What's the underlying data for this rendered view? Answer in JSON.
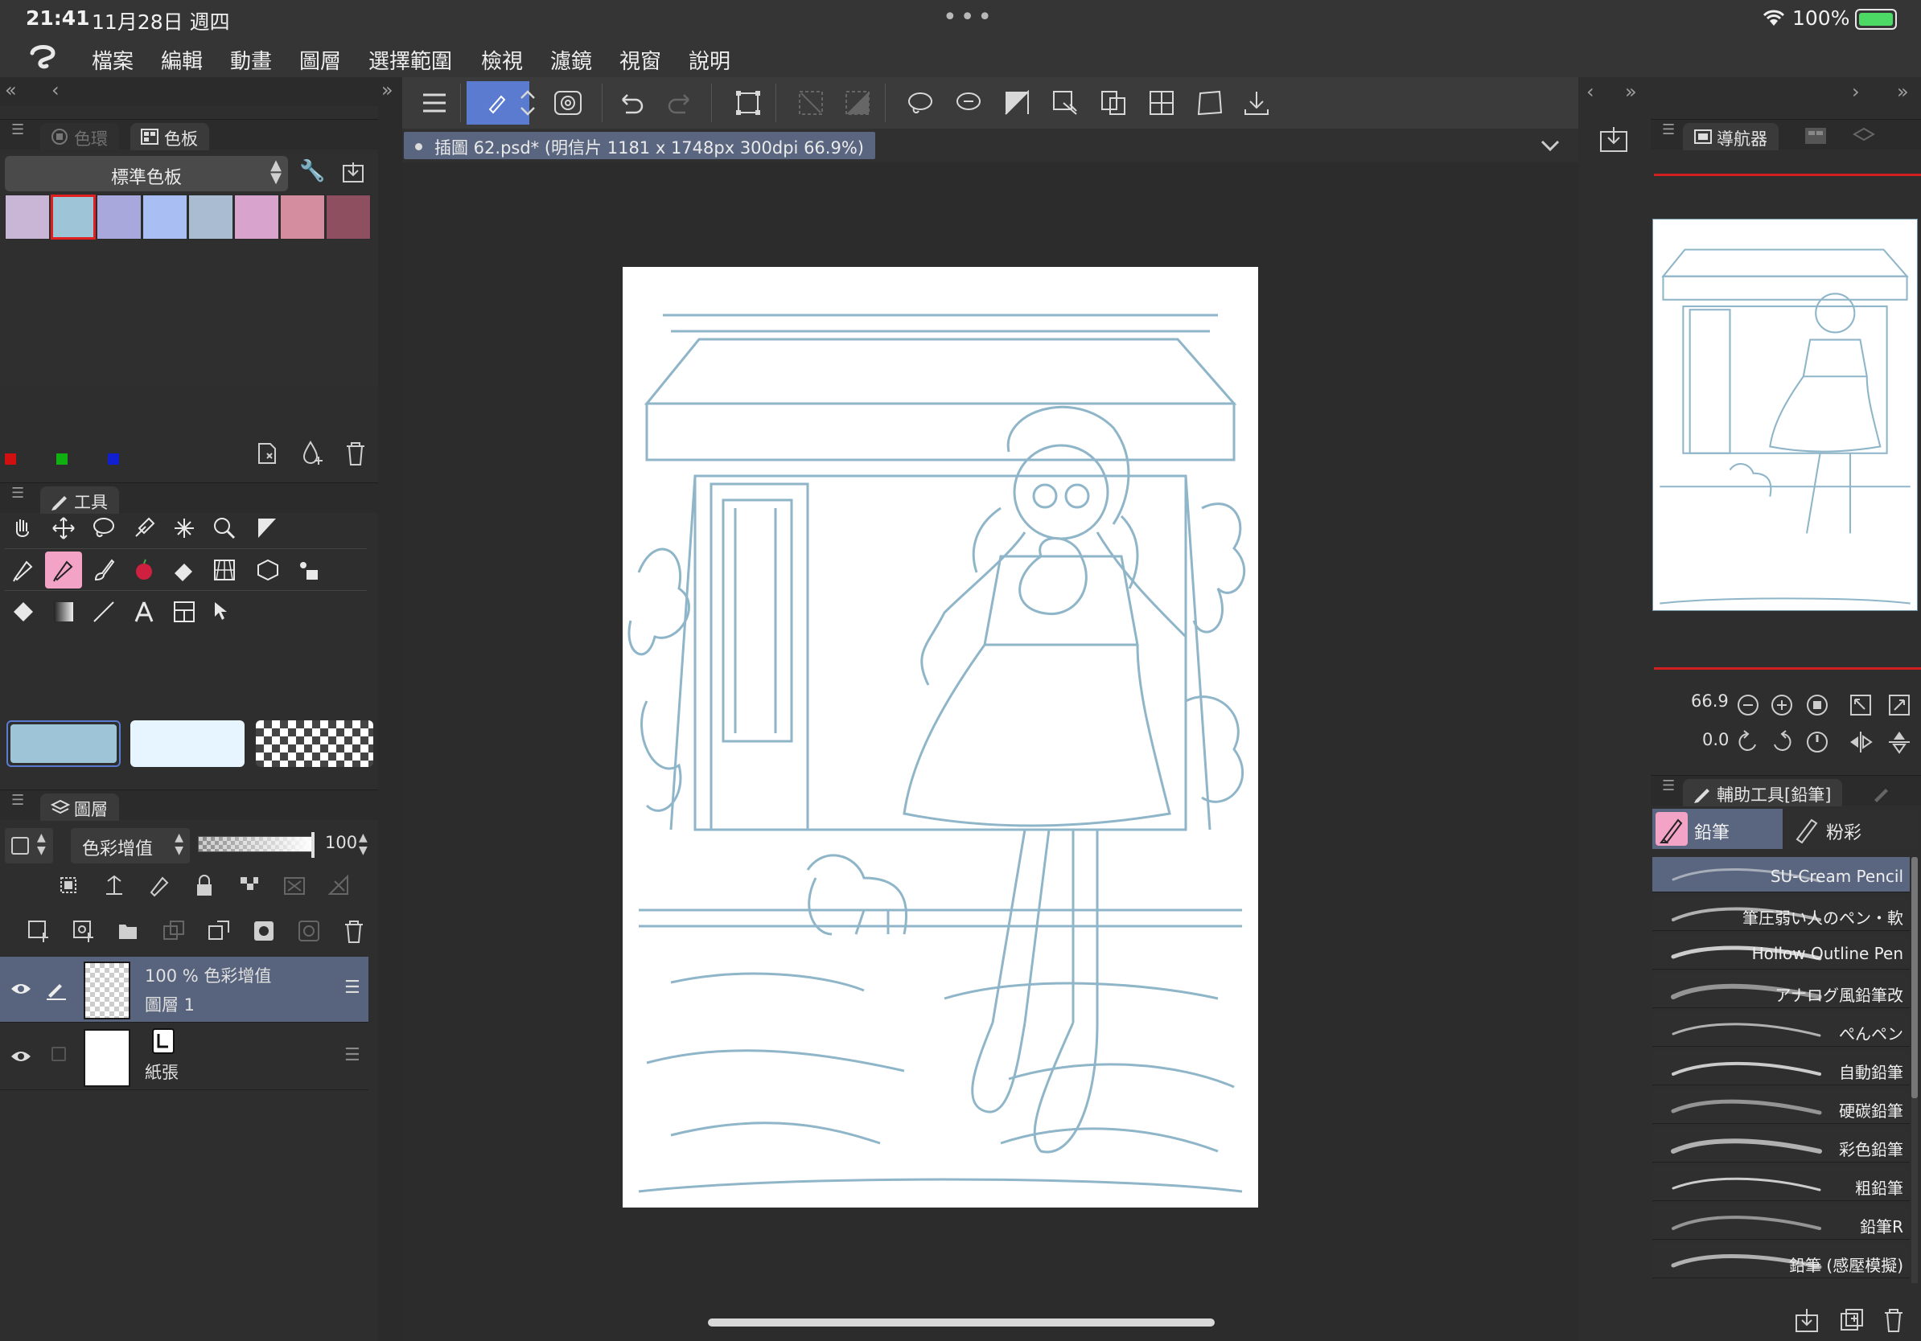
{
  "status": {
    "time": "21:41",
    "date": "11月28日 週四",
    "battery": "100%"
  },
  "menu": [
    "檔案",
    "編輯",
    "動畫",
    "圖層",
    "選擇範圍",
    "檢視",
    "濾鏡",
    "視窗",
    "說明"
  ],
  "palette_panel": {
    "tab_inactive": "色環",
    "tab_active": "色板",
    "palette_name": "標準色板",
    "swatches": [
      "#c9b6d6",
      "#9ec4d8",
      "#a8a8dc",
      "#a9bff4",
      "#a9bcd2",
      "#d8a3cc",
      "#d38d9e",
      "#8e5060"
    ]
  },
  "tool_panel": {
    "tab": "工具",
    "main_color": "#9ec4d8",
    "sub_color": "#e6f5ff"
  },
  "layer_panel": {
    "tab": "圖層",
    "blend_mode": "色彩增值",
    "opacity": "100",
    "opacity_fraction": 1.0,
    "layers": [
      {
        "mode": "100 % 色彩增值",
        "name": "圖層 1"
      },
      {
        "mode": "",
        "name": "紙張"
      }
    ]
  },
  "document": {
    "tab_label": "插圖 62.psd* (明信片 1181 x 1748px 300dpi 66.9%)"
  },
  "navigator": {
    "tab": "導航器",
    "zoom": "66.9",
    "rotation": "0.0"
  },
  "sub_tool": {
    "tab": "輔助工具[鉛筆]",
    "groups": [
      "鉛筆",
      "粉彩"
    ],
    "brushes": [
      "SU-Cream Pencil",
      "筆圧弱い人のペン・軟",
      "Hollow Outline Pen",
      "アナログ風鉛筆改",
      "ぺんペン",
      "自動鉛筆",
      "硬碳鉛筆",
      "彩色鉛筆",
      "粗鉛筆",
      "鉛筆R",
      "鉛筆 (感壓模擬)"
    ]
  }
}
